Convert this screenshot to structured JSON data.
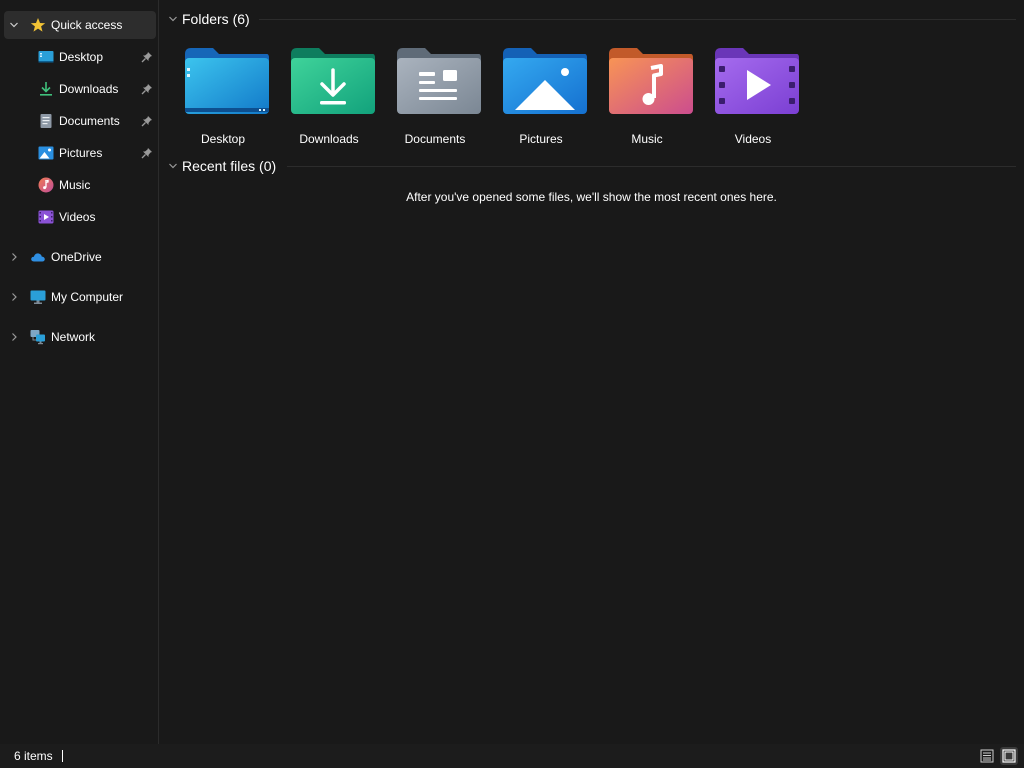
{
  "sidebar": {
    "quick_access": "Quick access",
    "items": [
      {
        "label": "Desktop",
        "icon": "desktop-icon",
        "pinned": true
      },
      {
        "label": "Downloads",
        "icon": "downloads-icon",
        "pinned": true
      },
      {
        "label": "Documents",
        "icon": "documents-icon",
        "pinned": true
      },
      {
        "label": "Pictures",
        "icon": "pictures-icon",
        "pinned": true
      },
      {
        "label": "Music",
        "icon": "music-icon",
        "pinned": false
      },
      {
        "label": "Videos",
        "icon": "videos-icon",
        "pinned": false
      }
    ],
    "roots": [
      {
        "label": "OneDrive",
        "icon": "cloud-icon"
      },
      {
        "label": "My Computer",
        "icon": "computer-icon"
      },
      {
        "label": "Network",
        "icon": "network-icon"
      }
    ]
  },
  "main": {
    "folders_header": "Folders (6)",
    "folders": [
      {
        "label": "Desktop",
        "icon": "desktop-folder-icon"
      },
      {
        "label": "Downloads",
        "icon": "downloads-folder-icon"
      },
      {
        "label": "Documents",
        "icon": "documents-folder-icon"
      },
      {
        "label": "Pictures",
        "icon": "pictures-folder-icon"
      },
      {
        "label": "Music",
        "icon": "music-folder-icon"
      },
      {
        "label": "Videos",
        "icon": "videos-folder-icon"
      }
    ],
    "recent_header": "Recent files (0)",
    "recent_empty_message": "After you've opened some files, we'll show the most recent ones here."
  },
  "status": {
    "item_count": "6 items"
  },
  "colors": {
    "background": "#191919",
    "selected": "#2d2d2d",
    "text": "#ffffff",
    "quick_access_star": "#f2c335"
  }
}
